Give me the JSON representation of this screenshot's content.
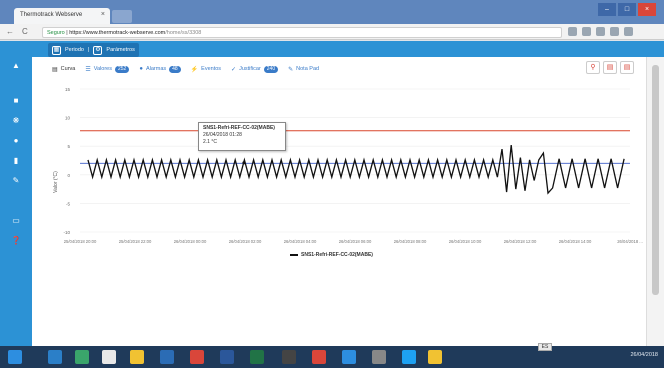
{
  "browser": {
    "tab_title": "Thermotrack Webserve",
    "tab_close": "×",
    "address": {
      "secure_label": "Seguro",
      "host": "https://www.thermotrack-webserve.com",
      "path": "/home/ss/3308"
    },
    "window_buttons": [
      "–",
      "□",
      "×"
    ],
    "nav": {
      "back": "←",
      "reload": "C"
    }
  },
  "app_header": {
    "periodo_label": "Periodo",
    "parametros_label": "Parámetros"
  },
  "toolbar": {
    "items": [
      {
        "label": "Curva",
        "icon": "chart-icon",
        "badge": ""
      },
      {
        "label": "Valores",
        "icon": "list-icon",
        "badge": "252"
      },
      {
        "label": "Alarmas",
        "icon": "bell-icon",
        "badge": "48"
      },
      {
        "label": "Eventos",
        "icon": "events-icon",
        "badge": ""
      },
      {
        "label": "Justificar",
        "icon": "check-icon",
        "badge": "240"
      },
      {
        "label": "Nota Pad",
        "icon": "note-icon",
        "badge": ""
      }
    ],
    "right_tools": [
      "search-icon",
      "pdf-icon",
      "file-icon"
    ]
  },
  "chart_data": {
    "type": "line",
    "ylabel": "Valor (°C)",
    "yticks": [
      "15",
      "10",
      "5",
      "0",
      "-5",
      "-10"
    ],
    "ylim": [
      -10,
      15
    ],
    "xticks": [
      "25/04/2018 20:00",
      "25/04/2018 22:00",
      "26/04/2018 00:00",
      "26/04/2018 02:00",
      "26/04/2018 04:00",
      "26/04/2018 06:00",
      "26/04/2018 08:00",
      "26/04/2018 10:00",
      "26/04/2018 12:00",
      "26/04/2018 14:00",
      "26/04/2018 ..."
    ],
    "thresholds": {
      "high": 7.7,
      "low": 2
    },
    "series": [
      {
        "name": "SNS1-Refri-REF-CC-02(MABE)",
        "color": "#111111",
        "pattern": "oscillating approx. -0.5 to 2.5 °C, spike to ~5 °C near 26/04/2018 12:00"
      }
    ],
    "tooltip": {
      "title": "SNS1-Refri-REF-CC-02(MABE)",
      "time": "26/04/2018 01:28",
      "value": "2.1 °C"
    },
    "legend_placement": "bottom-center",
    "colors": {
      "high_limit": "#d9472b",
      "low_limit": "#3e5ec8"
    }
  },
  "taskbar": {
    "lang": "ES",
    "tray_text": "26/04/2018"
  }
}
